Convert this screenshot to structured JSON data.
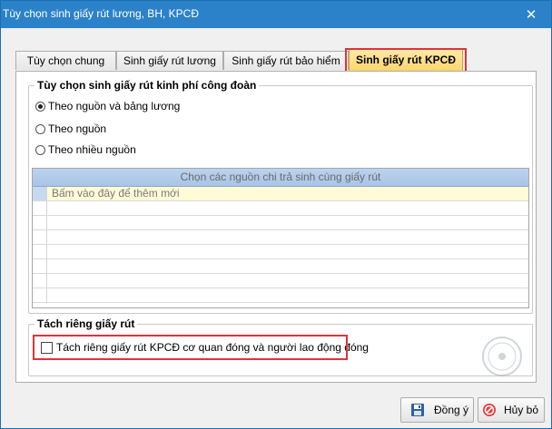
{
  "window": {
    "title": "Tùy chọn sinh giấy rút lương, BH, KPCĐ"
  },
  "tabs": [
    {
      "label": "Tùy chọn chung",
      "active": false
    },
    {
      "label": "Sinh giấy rút lương",
      "active": false
    },
    {
      "label": "Sinh giấy rút bảo hiểm",
      "active": false
    },
    {
      "label": "Sinh giấy rút KPCĐ",
      "active": true
    }
  ],
  "group_options": {
    "legend": "Tùy chọn sinh giấy rút kinh phí công đoàn",
    "radios": [
      {
        "label": "Theo nguồn và bảng lương",
        "checked": true
      },
      {
        "label": "Theo nguồn",
        "checked": false
      },
      {
        "label": "Theo nhiều nguồn",
        "checked": false
      }
    ],
    "grid": {
      "header": "Chọn các nguồn chi trả sinh cùng giấy rút",
      "new_row_hint": "Bấm vào đây để thêm mới"
    }
  },
  "group_split": {
    "legend": "Tách riêng giấy rút",
    "checkbox_label": "Tách riêng giấy rút KPCĐ cơ quan đóng và người lao động đóng",
    "checked": false
  },
  "buttons": {
    "ok": "Đồng ý",
    "cancel": "Hủy bỏ"
  },
  "icons": {
    "window": "app-icon",
    "close": "close-icon",
    "ok": "save-icon",
    "cancel": "cancel-icon"
  },
  "colors": {
    "titlebar": "#2b82c9",
    "active_tab": "#ffd66b",
    "highlight": "#e0333b",
    "grid_header": "#a9c4e6",
    "new_row": "#fffbd6"
  }
}
